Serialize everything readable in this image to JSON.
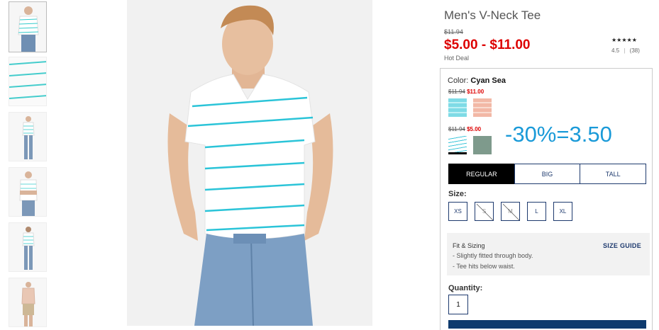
{
  "gallery": {
    "thumbnails": [
      "thumb-front",
      "thumb-fabric-detail",
      "thumb-full-front",
      "thumb-crossed-arms",
      "thumb-back",
      "thumb-other-color"
    ]
  },
  "product": {
    "title": "Men's V-Neck Tee",
    "original_price": "$11.94",
    "price": "$5.00 - $11.00",
    "deal_label": "Hot Deal",
    "stars": "★★★★★",
    "rating": "4.5",
    "reviews": "(38)",
    "rating_sep": "|"
  },
  "color": {
    "label": "Color:",
    "selected": "Cyan Sea",
    "groups": [
      {
        "strike": "$11.94",
        "sale": "$11.00"
      },
      {
        "strike": "$11.94",
        "sale": "$5.00"
      }
    ],
    "swatch_colors": [
      "#7fdbe6",
      "#f2b8a6",
      "#ffffff",
      "#7e9a8c"
    ]
  },
  "annotation": "-30%=3.50",
  "fit_tabs": [
    "REGULAR",
    "BIG",
    "TALL"
  ],
  "size": {
    "label": "Size:",
    "options": [
      "XS",
      "S",
      "M",
      "L",
      "XL"
    ]
  },
  "fit_sizing": {
    "title": "Fit & Sizing",
    "lines": [
      "- Slightly fitted through body.",
      "- Tee hits below waist."
    ],
    "guide": "SIZE GUIDE"
  },
  "quantity": {
    "label": "Quantity:",
    "value": "1"
  }
}
